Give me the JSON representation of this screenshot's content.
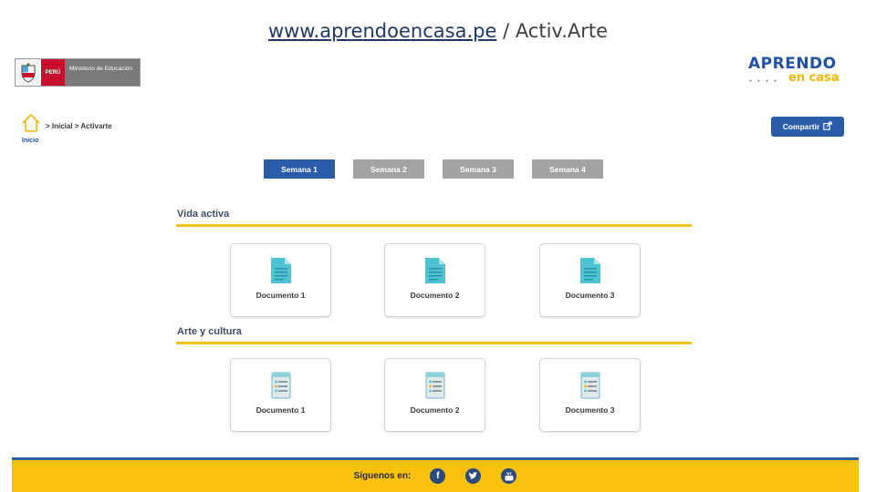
{
  "slide": {
    "title_link": "www.aprendoencasa.pe",
    "title_separator": " / ",
    "title_rest": "Activ.Arte"
  },
  "header": {
    "gov_logo": {
      "country": "PERÚ",
      "ministry": "Ministerio de Educación"
    },
    "brand": {
      "line1": "APRENDO",
      "line2": "en casa"
    }
  },
  "nav": {
    "home_label": "Inicio",
    "breadcrumb": "> Inicial > Activarte",
    "share_label": "Compartir"
  },
  "weeks": {
    "active_index": 0,
    "tabs": [
      "Semana 1",
      "Semana 2",
      "Semana 3",
      "Semana 4"
    ]
  },
  "sections": [
    {
      "title": "Vida activa",
      "icon": "document-icon",
      "cards": [
        "Documento 1",
        "Documento 2",
        "Documento 3"
      ]
    },
    {
      "title": "Arte y cultura",
      "icon": "checklist-document-icon",
      "cards": [
        "Documento 1",
        "Documento 2",
        "Documento 3"
      ]
    }
  ],
  "footer": {
    "label": "Síguenos en:",
    "social": [
      "facebook-icon",
      "twitter-icon",
      "youtube-icon"
    ]
  },
  "colors": {
    "primary_blue": "#2a5caa",
    "inactive_tab": "#a3a3a3",
    "accent_yellow": "#f8c10e",
    "brand_orange": "#f2b707"
  }
}
